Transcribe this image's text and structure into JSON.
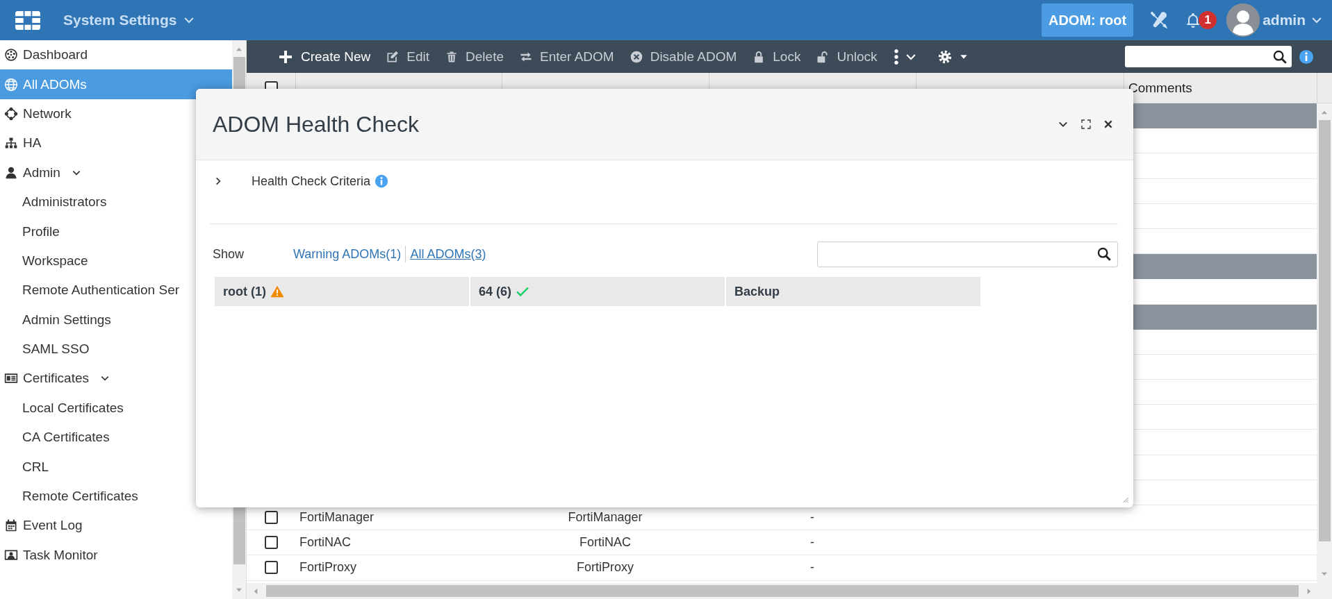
{
  "header": {
    "app_title": "System Settings",
    "adom_badge": "ADOM: root",
    "notification_count": "1",
    "user": "admin"
  },
  "sidebar": {
    "items": [
      {
        "label": "Dashboard",
        "selected": false
      },
      {
        "label": "All ADOMs",
        "selected": true
      },
      {
        "label": "Network",
        "selected": false
      },
      {
        "label": "HA",
        "selected": false
      },
      {
        "label": "Admin",
        "selected": false,
        "expanded": true,
        "children": [
          {
            "label": "Administrators",
            "selected": false
          },
          {
            "label": "Profile",
            "selected": false
          },
          {
            "label": "Workspace",
            "selected": false
          },
          {
            "label": "Remote Authentication Ser",
            "selected": false
          },
          {
            "label": "Admin Settings",
            "selected": false
          },
          {
            "label": "SAML SSO",
            "selected": false
          }
        ]
      },
      {
        "label": "Certificates",
        "selected": false,
        "expanded": true,
        "children": [
          {
            "label": "Local Certificates",
            "selected": false
          },
          {
            "label": "CA Certificates",
            "selected": false
          },
          {
            "label": "CRL",
            "selected": false
          },
          {
            "label": "Remote Certificates",
            "selected": false
          }
        ]
      },
      {
        "label": "Event Log",
        "selected": false
      },
      {
        "label": "Task Monitor",
        "selected": false
      }
    ]
  },
  "toolbar": {
    "buttons": [
      {
        "label": "Create New",
        "disabled": false
      },
      {
        "label": "Edit",
        "disabled": true
      },
      {
        "label": "Delete",
        "disabled": true
      },
      {
        "label": "Enter ADOM",
        "disabled": true
      },
      {
        "label": "Disable ADOM",
        "disabled": true
      },
      {
        "label": "Lock",
        "disabled": true
      },
      {
        "label": "Unlock",
        "disabled": true
      }
    ]
  },
  "table": {
    "select_all": {
      "checked": false
    },
    "columns": [
      "Comments"
    ],
    "rows": [
      {
        "kind": "group"
      },
      {
        "kind": "item"
      },
      {
        "kind": "item"
      },
      {
        "kind": "item"
      },
      {
        "kind": "item"
      },
      {
        "kind": "item"
      },
      {
        "kind": "group"
      },
      {
        "kind": "item"
      },
      {
        "kind": "group"
      },
      {
        "kind": "item"
      },
      {
        "kind": "item"
      },
      {
        "kind": "item"
      },
      {
        "kind": "item"
      },
      {
        "kind": "item"
      },
      {
        "kind": "item"
      },
      {
        "kind": "item"
      },
      {
        "kind": "item",
        "checked": false,
        "name": "FortiManager",
        "firmware": "FortiManager",
        "central_management": "-"
      },
      {
        "kind": "item",
        "checked": false,
        "name": "FortiNAC",
        "firmware": "FortiNAC",
        "central_management": "-"
      },
      {
        "kind": "item",
        "checked": false,
        "name": "FortiProxy",
        "firmware": "FortiProxy",
        "central_management": "-"
      }
    ]
  },
  "dialog": {
    "title": "ADOM Health Check",
    "criteria": {
      "label": "Health Check Criteria",
      "expanded": false
    },
    "show_label": "Show",
    "filters": [
      {
        "label": "Warning ADOMs(1)",
        "selected": false
      },
      {
        "label": "All ADOMs(3)",
        "selected": true
      }
    ],
    "results": [
      {
        "label": "root (1)",
        "kind": "warning"
      },
      {
        "label": "64 (6)",
        "kind": "ok"
      },
      {
        "label": "Backup",
        "kind": "plain"
      }
    ]
  }
}
